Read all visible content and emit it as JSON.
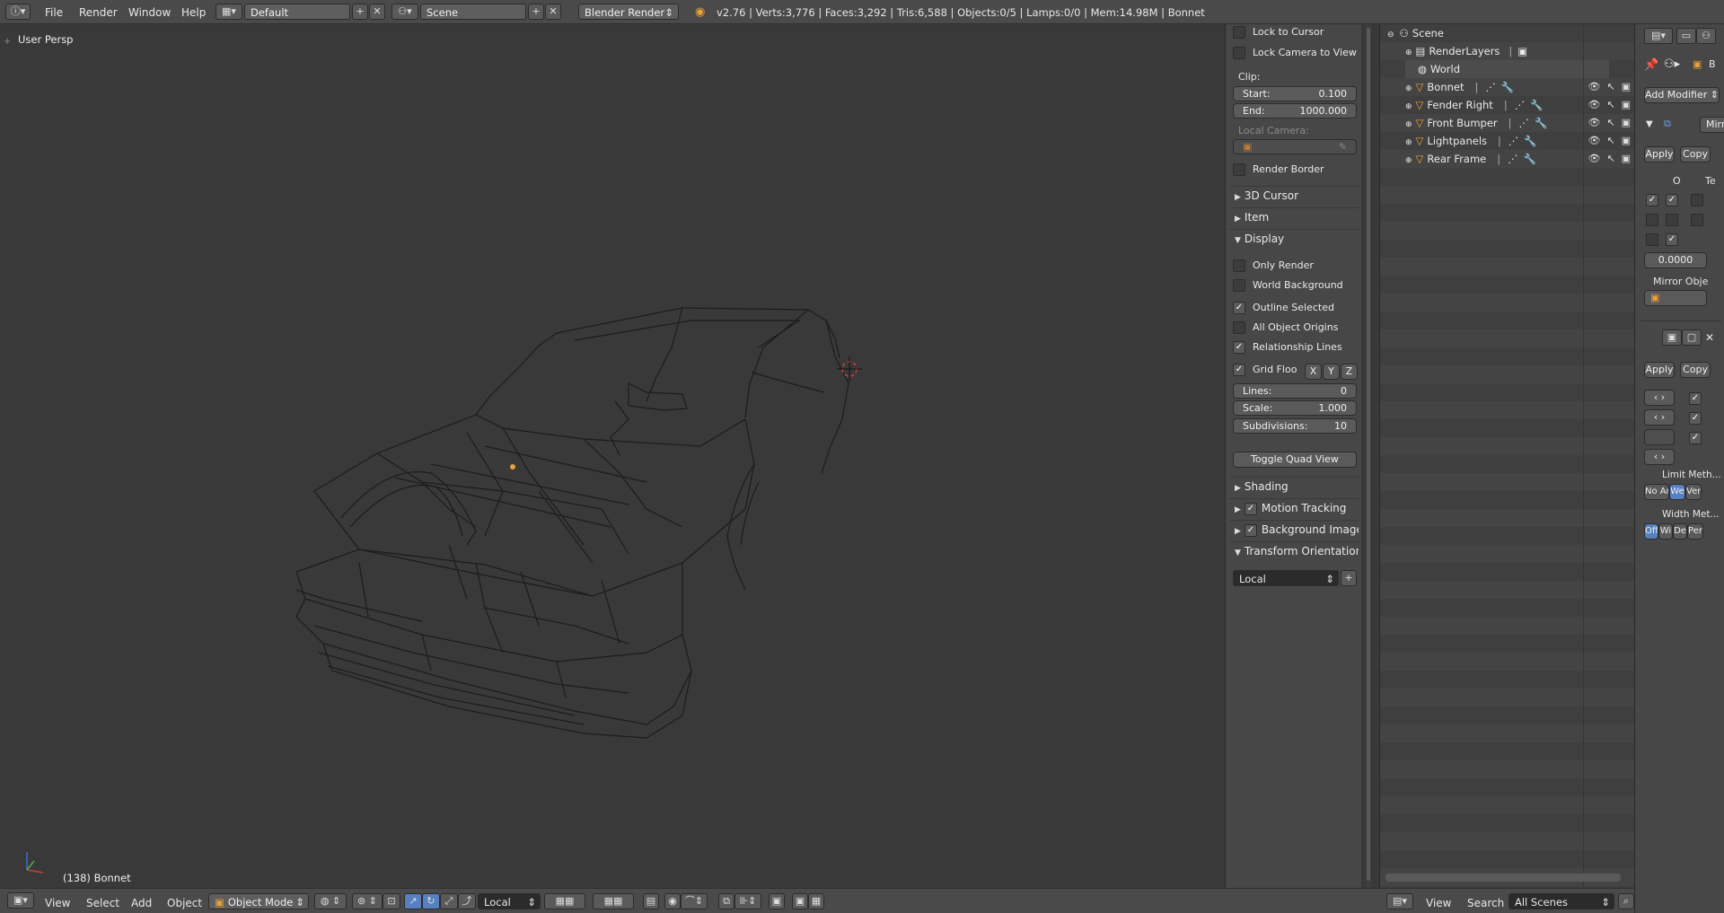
{
  "topbar": {
    "menus": [
      "File",
      "Render",
      "Window",
      "Help"
    ],
    "layout": "Default",
    "scene": "Scene",
    "engine": "Blender Render",
    "stats": "v2.76 | Verts:3,776 | Faces:3,292 | Tris:6,588 | Objects:0/5 | Lamps:0/0 | Mem:14.98M | Bonnet"
  },
  "viewport": {
    "view_label": "User Persp",
    "object_label": "(138) Bonnet"
  },
  "npanel": {
    "lock_cursor": "Lock to Cursor",
    "lock_camera": "Lock Camera to View",
    "clip_label": "Clip:",
    "clip_start_label": "Start:",
    "clip_start": "0.100",
    "clip_end_label": "End:",
    "clip_end": "1000.000",
    "local_camera": "Local Camera:",
    "render_border": "Render Border",
    "section_3d_cursor": "3D Cursor",
    "section_item": "Item",
    "section_display": "Display",
    "only_render": "Only Render",
    "world_background": "World Background",
    "outline_selected": "Outline Selected",
    "all_object_origins": "All Object Origins",
    "relationship_lines": "Relationship Lines",
    "grid_floor": "Grid Floo",
    "axis_x": "X",
    "axis_y": "Y",
    "axis_z": "Z",
    "lines_label": "Lines:",
    "lines_value": "0",
    "scale_label": "Scale:",
    "scale_value": "1.000",
    "subdiv_label": "Subdivisions:",
    "subdiv_value": "10",
    "toggle_quad": "Toggle Quad View",
    "section_shading": "Shading",
    "section_motion": "Motion Tracking",
    "section_background": "Background Images",
    "section_transform": "Transform Orientations",
    "orientation_value": "Local"
  },
  "outliner": {
    "scene": "Scene",
    "renderlayers": "RenderLayers",
    "world": "World",
    "objects": [
      "Bonnet",
      "Fender Right",
      "Front Bumper",
      "Lightpanels",
      "Rear Frame"
    ],
    "menu_view": "View",
    "menu_search": "Search",
    "scenes_select": "All Scenes"
  },
  "props": {
    "add_modifier": "Add Modifier",
    "mod1_name": "Mirr",
    "apply": "Apply",
    "copy": "Copy",
    "col_o": "O",
    "col_te": "Te",
    "merge_value": "0.0000",
    "mirror_object": "Mirror Obje",
    "limit_method": "Limit Meth...",
    "limit_opts": [
      "No An",
      "We",
      "Ver"
    ],
    "width_method": "Width Met...",
    "width_opts": [
      "Off",
      "Wi",
      "De",
      "Per"
    ],
    "tab_b": "B"
  },
  "bottombar": {
    "menus": [
      "View",
      "Select",
      "Add",
      "Object"
    ],
    "mode": "Object Mode",
    "orientation": "Local"
  },
  "colors": {
    "accent_blue": "#5680c2",
    "origin_orange": "#f0a030",
    "cursor_red": "#d23c3c"
  }
}
